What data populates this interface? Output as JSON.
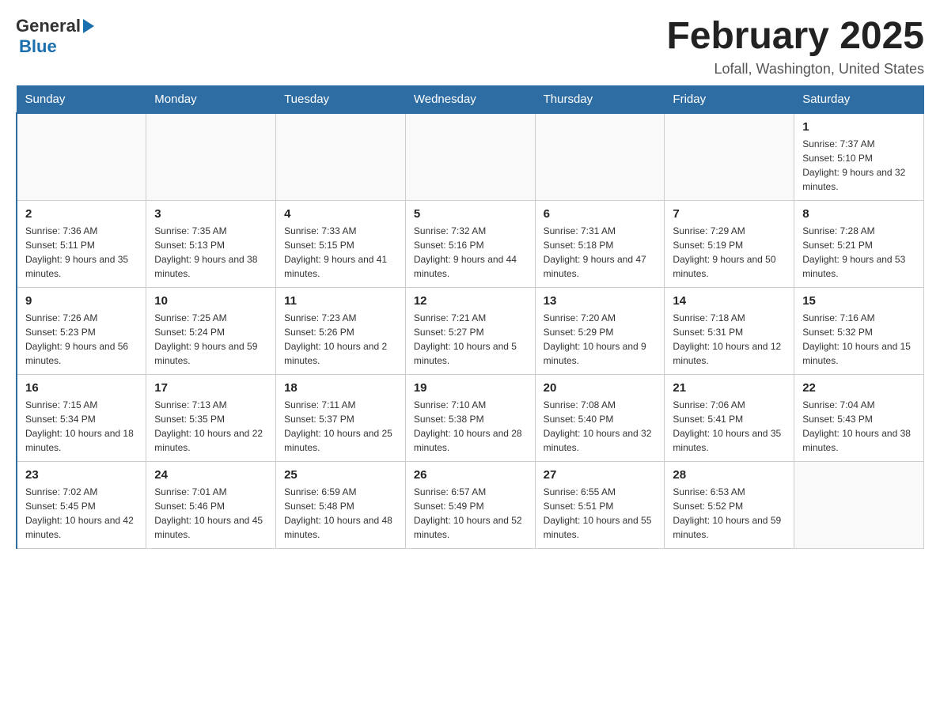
{
  "header": {
    "logo_general": "General",
    "logo_blue": "Blue",
    "title": "February 2025",
    "subtitle": "Lofall, Washington, United States"
  },
  "days_of_week": [
    "Sunday",
    "Monday",
    "Tuesday",
    "Wednesday",
    "Thursday",
    "Friday",
    "Saturday"
  ],
  "weeks": [
    [
      {
        "day": "",
        "info": ""
      },
      {
        "day": "",
        "info": ""
      },
      {
        "day": "",
        "info": ""
      },
      {
        "day": "",
        "info": ""
      },
      {
        "day": "",
        "info": ""
      },
      {
        "day": "",
        "info": ""
      },
      {
        "day": "1",
        "info": "Sunrise: 7:37 AM\nSunset: 5:10 PM\nDaylight: 9 hours and 32 minutes."
      }
    ],
    [
      {
        "day": "2",
        "info": "Sunrise: 7:36 AM\nSunset: 5:11 PM\nDaylight: 9 hours and 35 minutes."
      },
      {
        "day": "3",
        "info": "Sunrise: 7:35 AM\nSunset: 5:13 PM\nDaylight: 9 hours and 38 minutes."
      },
      {
        "day": "4",
        "info": "Sunrise: 7:33 AM\nSunset: 5:15 PM\nDaylight: 9 hours and 41 minutes."
      },
      {
        "day": "5",
        "info": "Sunrise: 7:32 AM\nSunset: 5:16 PM\nDaylight: 9 hours and 44 minutes."
      },
      {
        "day": "6",
        "info": "Sunrise: 7:31 AM\nSunset: 5:18 PM\nDaylight: 9 hours and 47 minutes."
      },
      {
        "day": "7",
        "info": "Sunrise: 7:29 AM\nSunset: 5:19 PM\nDaylight: 9 hours and 50 minutes."
      },
      {
        "day": "8",
        "info": "Sunrise: 7:28 AM\nSunset: 5:21 PM\nDaylight: 9 hours and 53 minutes."
      }
    ],
    [
      {
        "day": "9",
        "info": "Sunrise: 7:26 AM\nSunset: 5:23 PM\nDaylight: 9 hours and 56 minutes."
      },
      {
        "day": "10",
        "info": "Sunrise: 7:25 AM\nSunset: 5:24 PM\nDaylight: 9 hours and 59 minutes."
      },
      {
        "day": "11",
        "info": "Sunrise: 7:23 AM\nSunset: 5:26 PM\nDaylight: 10 hours and 2 minutes."
      },
      {
        "day": "12",
        "info": "Sunrise: 7:21 AM\nSunset: 5:27 PM\nDaylight: 10 hours and 5 minutes."
      },
      {
        "day": "13",
        "info": "Sunrise: 7:20 AM\nSunset: 5:29 PM\nDaylight: 10 hours and 9 minutes."
      },
      {
        "day": "14",
        "info": "Sunrise: 7:18 AM\nSunset: 5:31 PM\nDaylight: 10 hours and 12 minutes."
      },
      {
        "day": "15",
        "info": "Sunrise: 7:16 AM\nSunset: 5:32 PM\nDaylight: 10 hours and 15 minutes."
      }
    ],
    [
      {
        "day": "16",
        "info": "Sunrise: 7:15 AM\nSunset: 5:34 PM\nDaylight: 10 hours and 18 minutes."
      },
      {
        "day": "17",
        "info": "Sunrise: 7:13 AM\nSunset: 5:35 PM\nDaylight: 10 hours and 22 minutes."
      },
      {
        "day": "18",
        "info": "Sunrise: 7:11 AM\nSunset: 5:37 PM\nDaylight: 10 hours and 25 minutes."
      },
      {
        "day": "19",
        "info": "Sunrise: 7:10 AM\nSunset: 5:38 PM\nDaylight: 10 hours and 28 minutes."
      },
      {
        "day": "20",
        "info": "Sunrise: 7:08 AM\nSunset: 5:40 PM\nDaylight: 10 hours and 32 minutes."
      },
      {
        "day": "21",
        "info": "Sunrise: 7:06 AM\nSunset: 5:41 PM\nDaylight: 10 hours and 35 minutes."
      },
      {
        "day": "22",
        "info": "Sunrise: 7:04 AM\nSunset: 5:43 PM\nDaylight: 10 hours and 38 minutes."
      }
    ],
    [
      {
        "day": "23",
        "info": "Sunrise: 7:02 AM\nSunset: 5:45 PM\nDaylight: 10 hours and 42 minutes."
      },
      {
        "day": "24",
        "info": "Sunrise: 7:01 AM\nSunset: 5:46 PM\nDaylight: 10 hours and 45 minutes."
      },
      {
        "day": "25",
        "info": "Sunrise: 6:59 AM\nSunset: 5:48 PM\nDaylight: 10 hours and 48 minutes."
      },
      {
        "day": "26",
        "info": "Sunrise: 6:57 AM\nSunset: 5:49 PM\nDaylight: 10 hours and 52 minutes."
      },
      {
        "day": "27",
        "info": "Sunrise: 6:55 AM\nSunset: 5:51 PM\nDaylight: 10 hours and 55 minutes."
      },
      {
        "day": "28",
        "info": "Sunrise: 6:53 AM\nSunset: 5:52 PM\nDaylight: 10 hours and 59 minutes."
      },
      {
        "day": "",
        "info": ""
      }
    ]
  ]
}
